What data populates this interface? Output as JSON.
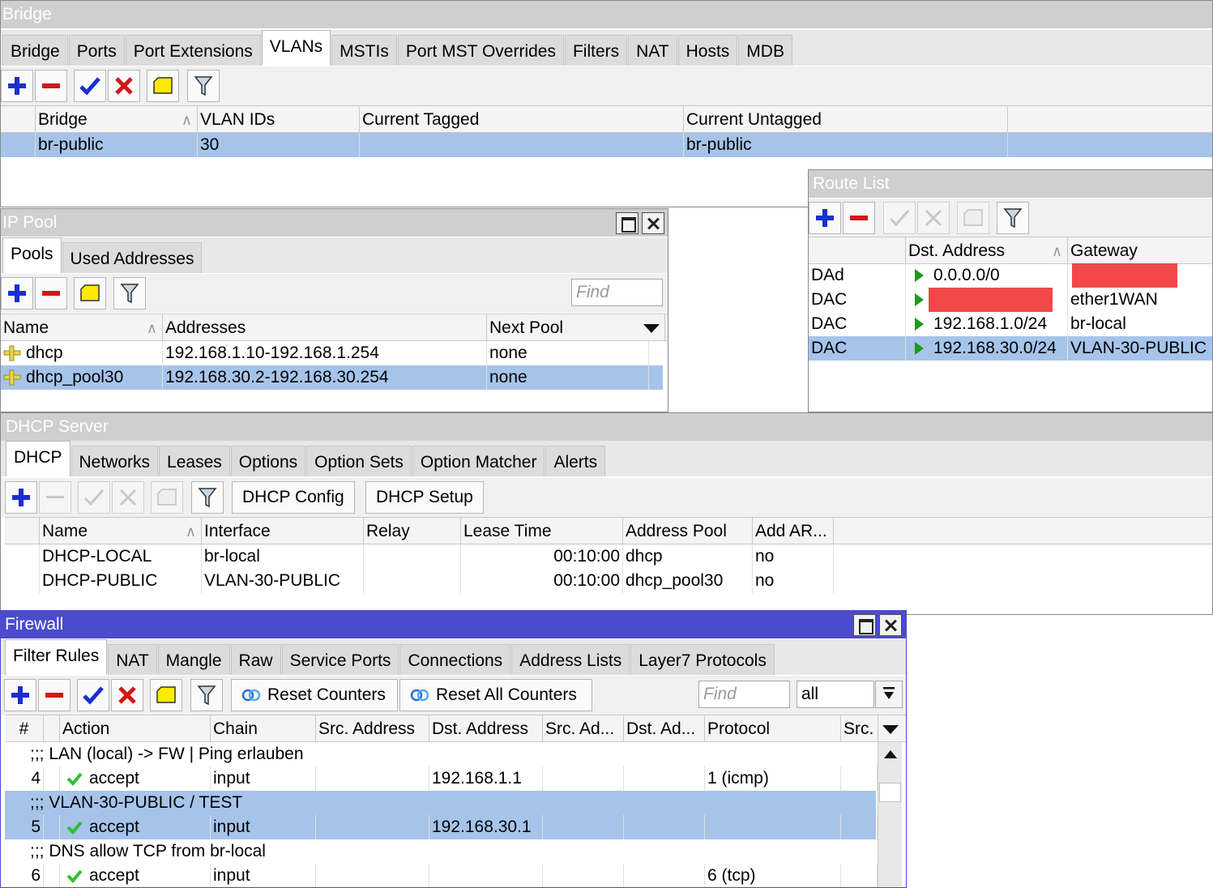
{
  "bridge": {
    "title": "Bridge",
    "tabs": [
      "Bridge",
      "Ports",
      "Port Extensions",
      "VLANs",
      "MSTIs",
      "Port MST Overrides",
      "Filters",
      "NAT",
      "Hosts",
      "MDB"
    ],
    "columns": [
      "Bridge",
      "VLAN IDs",
      "Current Tagged",
      "Current Untagged"
    ],
    "rows": [
      {
        "bridge": "br-public",
        "vlan_ids": "30",
        "tagged": "",
        "untagged": "br-public"
      }
    ]
  },
  "ip_pool": {
    "title": "IP Pool",
    "tabs": [
      "Pools",
      "Used Addresses"
    ],
    "find_placeholder": "Find",
    "columns": [
      "Name",
      "Addresses",
      "Next Pool"
    ],
    "rows": [
      {
        "name": "dhcp",
        "addresses": "192.168.1.10-192.168.1.254",
        "next": "none"
      },
      {
        "name": "dhcp_pool30",
        "addresses": "192.168.30.2-192.168.30.254",
        "next": "none"
      }
    ]
  },
  "route_list": {
    "title": "Route List",
    "columns": [
      "Dst. Address",
      "Gateway"
    ],
    "rows": [
      {
        "flags": "DAd",
        "dst": "0.0.0.0/0",
        "gateway": ""
      },
      {
        "flags": "DAC",
        "dst": "",
        "gateway": "ether1WAN"
      },
      {
        "flags": "DAC",
        "dst": "192.168.1.0/24",
        "gateway": "br-local"
      },
      {
        "flags": "DAC",
        "dst": "192.168.30.0/24",
        "gateway": "VLAN-30-PUBLIC"
      }
    ]
  },
  "dhcp_server": {
    "title": "DHCP Server",
    "tabs": [
      "DHCP",
      "Networks",
      "Leases",
      "Options",
      "Option Sets",
      "Option Matcher",
      "Alerts"
    ],
    "buttons": {
      "config": "DHCP Config",
      "setup": "DHCP Setup"
    },
    "columns": [
      "Name",
      "Interface",
      "Relay",
      "Lease Time",
      "Address Pool",
      "Add AR..."
    ],
    "rows": [
      {
        "name": "DHCP-LOCAL",
        "iface": "br-local",
        "relay": "",
        "lease": "00:10:00",
        "pool": "dhcp",
        "arp": "no"
      },
      {
        "name": "DHCP-PUBLIC",
        "iface": "VLAN-30-PUBLIC",
        "relay": "",
        "lease": "00:10:00",
        "pool": "dhcp_pool30",
        "arp": "no"
      }
    ]
  },
  "firewall": {
    "title": "Firewall",
    "tabs": [
      "Filter Rules",
      "NAT",
      "Mangle",
      "Raw",
      "Service Ports",
      "Connections",
      "Address Lists",
      "Layer7 Protocols"
    ],
    "buttons": {
      "reset": "Reset Counters",
      "reset_all": "Reset All Counters"
    },
    "find_placeholder": "Find",
    "filter_value": "all",
    "columns": [
      "#",
      "Action",
      "Chain",
      "Src. Address",
      "Dst. Address",
      "Src. Ad...",
      "Dst. Ad...",
      "Protocol",
      "Src."
    ],
    "comments": [
      ";;; LAN (local) -> FW | Ping erlauben",
      ";;; VLAN-30-PUBLIC / TEST",
      ";;; DNS allow TCP from br-local"
    ],
    "rules": [
      {
        "num": "4",
        "action": "accept",
        "chain": "input",
        "dst": "192.168.1.1",
        "protocol": "1 (icmp)"
      },
      {
        "num": "5",
        "action": "accept",
        "chain": "input",
        "dst": "192.168.30.1",
        "protocol": ""
      },
      {
        "num": "6",
        "action": "accept",
        "chain": "input",
        "dst": "",
        "protocol": "6 (tcp)"
      }
    ]
  },
  "colors": {
    "selection": "#a6c4ea",
    "active_title": "#4b4bce",
    "inactive_title": "#cfcfcf",
    "add": "#1a2fd0",
    "remove": "#d01818",
    "accept": "#2fbf2f",
    "redacted": "#f0484b"
  }
}
